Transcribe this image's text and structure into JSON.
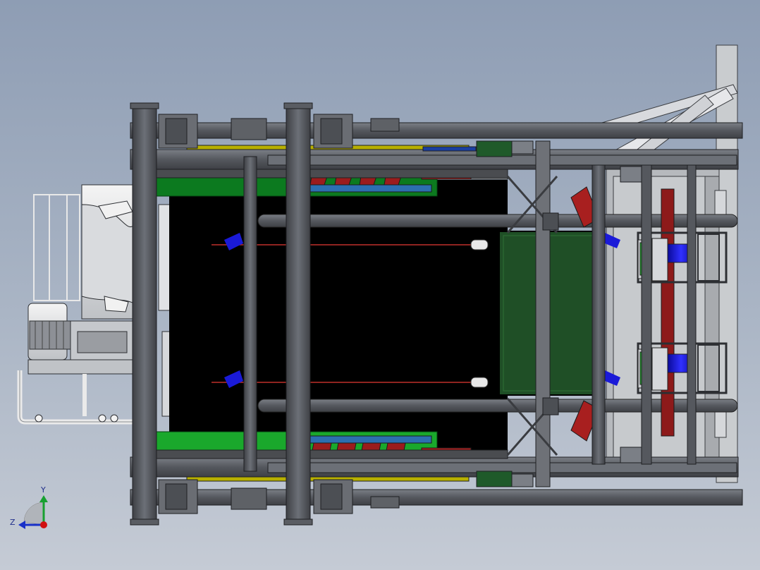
{
  "colors": {
    "background_top": "#8e9db4",
    "background_bottom": "#c5cbd5",
    "frame_steel": "#5a5d63",
    "frame_steel_dark": "#3a3c40",
    "belt": "#000000",
    "belt_edge_green": "#0c7a1f",
    "skirt_plate_green": "#1f5a2a",
    "roller_red": "#9b1c1c",
    "motor_blue": "#1a1ad8",
    "highlight_yellow": "#b8b000",
    "cable_red": "#c0302a",
    "axis_x": "#d01010",
    "axis_y": "#18a030",
    "axis_z": "#1830c8"
  },
  "icons": {
    "triad": "coordinate-triad-icon"
  },
  "triad": {
    "y_label": "Y",
    "z_label": "Z"
  }
}
